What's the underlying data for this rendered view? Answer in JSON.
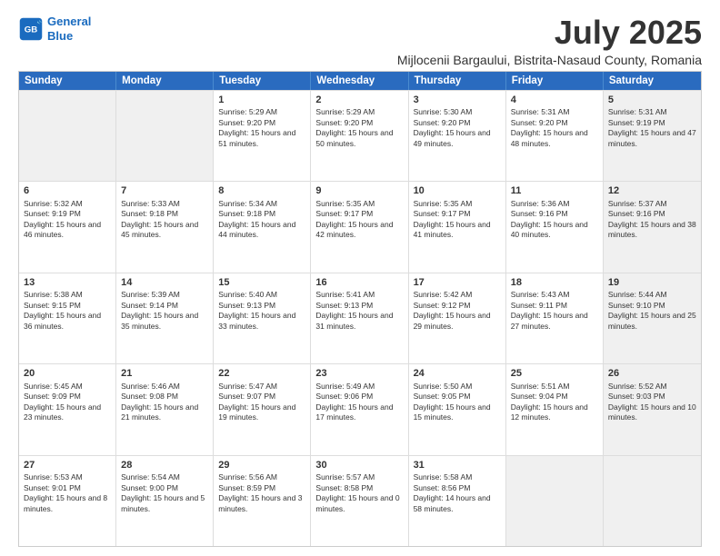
{
  "logo": {
    "line1": "General",
    "line2": "Blue"
  },
  "title": "July 2025",
  "subtitle": "Mijlocenii Bargaului, Bistrita-Nasaud County, Romania",
  "header_days": [
    "Sunday",
    "Monday",
    "Tuesday",
    "Wednesday",
    "Thursday",
    "Friday",
    "Saturday"
  ],
  "rows": [
    [
      {
        "day": "",
        "info": "",
        "shaded": true
      },
      {
        "day": "",
        "info": "",
        "shaded": true
      },
      {
        "day": "1",
        "info": "Sunrise: 5:29 AM\nSunset: 9:20 PM\nDaylight: 15 hours and 51 minutes."
      },
      {
        "day": "2",
        "info": "Sunrise: 5:29 AM\nSunset: 9:20 PM\nDaylight: 15 hours and 50 minutes."
      },
      {
        "day": "3",
        "info": "Sunrise: 5:30 AM\nSunset: 9:20 PM\nDaylight: 15 hours and 49 minutes."
      },
      {
        "day": "4",
        "info": "Sunrise: 5:31 AM\nSunset: 9:20 PM\nDaylight: 15 hours and 48 minutes."
      },
      {
        "day": "5",
        "info": "Sunrise: 5:31 AM\nSunset: 9:19 PM\nDaylight: 15 hours and 47 minutes.",
        "shaded": true
      }
    ],
    [
      {
        "day": "6",
        "info": "Sunrise: 5:32 AM\nSunset: 9:19 PM\nDaylight: 15 hours and 46 minutes."
      },
      {
        "day": "7",
        "info": "Sunrise: 5:33 AM\nSunset: 9:18 PM\nDaylight: 15 hours and 45 minutes."
      },
      {
        "day": "8",
        "info": "Sunrise: 5:34 AM\nSunset: 9:18 PM\nDaylight: 15 hours and 44 minutes."
      },
      {
        "day": "9",
        "info": "Sunrise: 5:35 AM\nSunset: 9:17 PM\nDaylight: 15 hours and 42 minutes."
      },
      {
        "day": "10",
        "info": "Sunrise: 5:35 AM\nSunset: 9:17 PM\nDaylight: 15 hours and 41 minutes."
      },
      {
        "day": "11",
        "info": "Sunrise: 5:36 AM\nSunset: 9:16 PM\nDaylight: 15 hours and 40 minutes."
      },
      {
        "day": "12",
        "info": "Sunrise: 5:37 AM\nSunset: 9:16 PM\nDaylight: 15 hours and 38 minutes.",
        "shaded": true
      }
    ],
    [
      {
        "day": "13",
        "info": "Sunrise: 5:38 AM\nSunset: 9:15 PM\nDaylight: 15 hours and 36 minutes."
      },
      {
        "day": "14",
        "info": "Sunrise: 5:39 AM\nSunset: 9:14 PM\nDaylight: 15 hours and 35 minutes."
      },
      {
        "day": "15",
        "info": "Sunrise: 5:40 AM\nSunset: 9:13 PM\nDaylight: 15 hours and 33 minutes."
      },
      {
        "day": "16",
        "info": "Sunrise: 5:41 AM\nSunset: 9:13 PM\nDaylight: 15 hours and 31 minutes."
      },
      {
        "day": "17",
        "info": "Sunrise: 5:42 AM\nSunset: 9:12 PM\nDaylight: 15 hours and 29 minutes."
      },
      {
        "day": "18",
        "info": "Sunrise: 5:43 AM\nSunset: 9:11 PM\nDaylight: 15 hours and 27 minutes."
      },
      {
        "day": "19",
        "info": "Sunrise: 5:44 AM\nSunset: 9:10 PM\nDaylight: 15 hours and 25 minutes.",
        "shaded": true
      }
    ],
    [
      {
        "day": "20",
        "info": "Sunrise: 5:45 AM\nSunset: 9:09 PM\nDaylight: 15 hours and 23 minutes."
      },
      {
        "day": "21",
        "info": "Sunrise: 5:46 AM\nSunset: 9:08 PM\nDaylight: 15 hours and 21 minutes."
      },
      {
        "day": "22",
        "info": "Sunrise: 5:47 AM\nSunset: 9:07 PM\nDaylight: 15 hours and 19 minutes."
      },
      {
        "day": "23",
        "info": "Sunrise: 5:49 AM\nSunset: 9:06 PM\nDaylight: 15 hours and 17 minutes."
      },
      {
        "day": "24",
        "info": "Sunrise: 5:50 AM\nSunset: 9:05 PM\nDaylight: 15 hours and 15 minutes."
      },
      {
        "day": "25",
        "info": "Sunrise: 5:51 AM\nSunset: 9:04 PM\nDaylight: 15 hours and 12 minutes."
      },
      {
        "day": "26",
        "info": "Sunrise: 5:52 AM\nSunset: 9:03 PM\nDaylight: 15 hours and 10 minutes.",
        "shaded": true
      }
    ],
    [
      {
        "day": "27",
        "info": "Sunrise: 5:53 AM\nSunset: 9:01 PM\nDaylight: 15 hours and 8 minutes."
      },
      {
        "day": "28",
        "info": "Sunrise: 5:54 AM\nSunset: 9:00 PM\nDaylight: 15 hours and 5 minutes."
      },
      {
        "day": "29",
        "info": "Sunrise: 5:56 AM\nSunset: 8:59 PM\nDaylight: 15 hours and 3 minutes."
      },
      {
        "day": "30",
        "info": "Sunrise: 5:57 AM\nSunset: 8:58 PM\nDaylight: 15 hours and 0 minutes."
      },
      {
        "day": "31",
        "info": "Sunrise: 5:58 AM\nSunset: 8:56 PM\nDaylight: 14 hours and 58 minutes."
      },
      {
        "day": "",
        "info": "",
        "shaded": true
      },
      {
        "day": "",
        "info": "",
        "shaded": true
      }
    ]
  ]
}
